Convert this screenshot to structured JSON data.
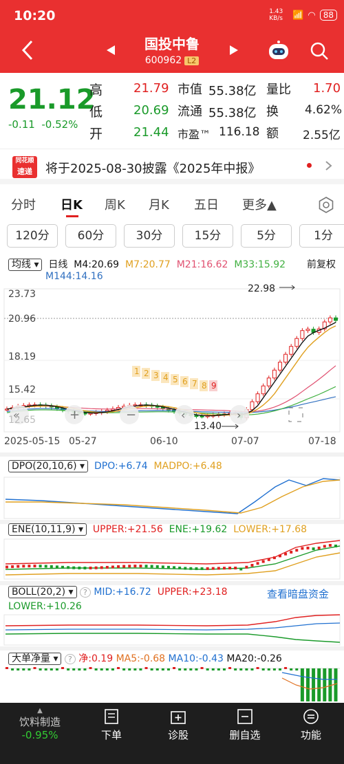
{
  "status": {
    "time": "10:20",
    "net_speed": "1.43 KB/s",
    "battery": "88"
  },
  "header": {
    "title": "国投中鲁",
    "code": "600962",
    "level": "L2"
  },
  "quote": {
    "price": "21.12",
    "change": "-0.11",
    "change_pct": "-0.52%",
    "high_label": "高",
    "high": "21.79",
    "low_label": "低",
    "low": "20.69",
    "open_label": "开",
    "open": "21.44",
    "mcap_label": "市值",
    "mcap": "55.38亿",
    "float_label": "流通",
    "float": "55.38亿",
    "pe_label": "市盈™",
    "pe": "116.18",
    "vol_ratio_label": "量比",
    "vol_ratio": "1.70",
    "turnover_label": "换",
    "turnover": "4.62%",
    "amount_label": "额",
    "amount": "2.55亿"
  },
  "notice": {
    "logo_top": "同花顺",
    "logo_bottom": "速递",
    "text": "将于2025-08-30披露《2025年中报》"
  },
  "period_tabs": [
    "分时",
    "日K",
    "周K",
    "月K",
    "五日",
    "更多▲"
  ],
  "sub_tabs": [
    "120分",
    "60分",
    "30分",
    "15分",
    "5分",
    "1分"
  ],
  "kline": {
    "selector": "均线",
    "period": "日线",
    "m4": "M4:20.69",
    "m7": "M7:20.77",
    "m21": "M21:16.62",
    "m33": "M33:15.92",
    "m144": "M144:14.16",
    "adjust": "前复权",
    "y_ticks": [
      "23.73",
      "20.96",
      "18.19",
      "15.42",
      "12.65"
    ],
    "x_ticks": [
      "2025-05-15",
      "05-27",
      "06-10",
      "07-07",
      "07-18"
    ],
    "max_label": "22.98",
    "min_label": "13.40",
    "nine_seq": [
      "1",
      "2",
      "3",
      "4",
      "5",
      "6",
      "7",
      "8",
      "9"
    ]
  },
  "dpo": {
    "name": "DPO(20,10,6)",
    "dpo": "DPO:+6.74",
    "madpo": "MADPO:+6.48"
  },
  "ene": {
    "name": "ENE(10,11,9)",
    "upper": "UPPER:+21.56",
    "ene": "ENE:+19.62",
    "lower": "LOWER:+17.68"
  },
  "boll": {
    "name": "BOLL(20,2)",
    "mid": "MID:+16.72",
    "upper": "UPPER:+23.18",
    "link": "查看暗盘资金",
    "lower": "LOWER:+10.26"
  },
  "bigorder": {
    "name": "大单净量",
    "net": "净:0.19",
    "ma5": "MA5:-0.68",
    "ma10": "MA10:-0.43",
    "ma20": "MA20:-0.26"
  },
  "bottom": {
    "sector": "饮料制造",
    "sector_change": "-0.95%",
    "btn1": "下单",
    "btn2": "诊股",
    "btn3": "删自选",
    "btn4": "功能"
  },
  "colors": {
    "header_red": "#e93030",
    "rise": "#e02020",
    "fall": "#1a9a2a",
    "m4": "#111111",
    "m7": "#e0a020",
    "m21": "#e05070",
    "m33": "#40b040",
    "m144": "#3070c0"
  }
}
